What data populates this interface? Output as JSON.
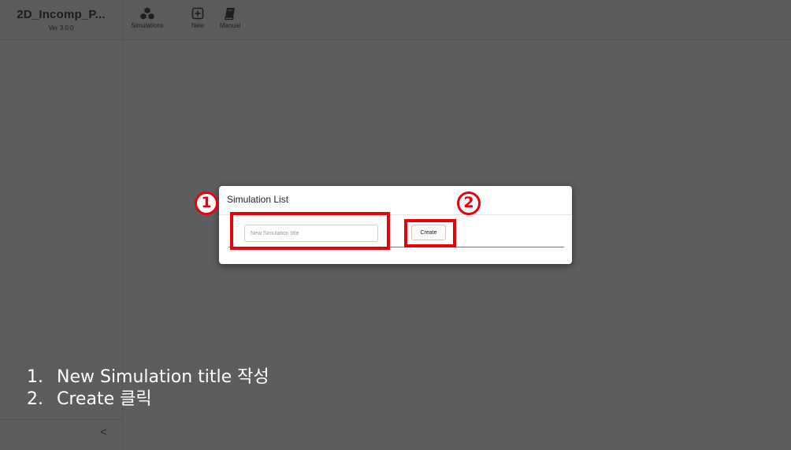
{
  "app": {
    "title": "2D_Incomp_P...",
    "version": "Ver 3.0.0"
  },
  "toolbar": [
    {
      "label": "Simulations",
      "icon": "cubes-icon"
    },
    {
      "label": "New",
      "icon": "plus-square-icon"
    },
    {
      "label": "Manual",
      "icon": "book-icon"
    }
  ],
  "modal": {
    "title": "Simulation List",
    "input_placeholder": "New Simulation title",
    "input_value": "",
    "create_label": "Create"
  },
  "annotations": {
    "marker_1": "1",
    "marker_2": "2",
    "highlight_color": "#e8000b"
  },
  "instructions": [
    {
      "index": "1.",
      "text": "New Simulation title 작성"
    },
    {
      "index": "2.",
      "text": "Create 클릭"
    }
  ],
  "sidebar": {
    "collapse_glyph": "<"
  }
}
